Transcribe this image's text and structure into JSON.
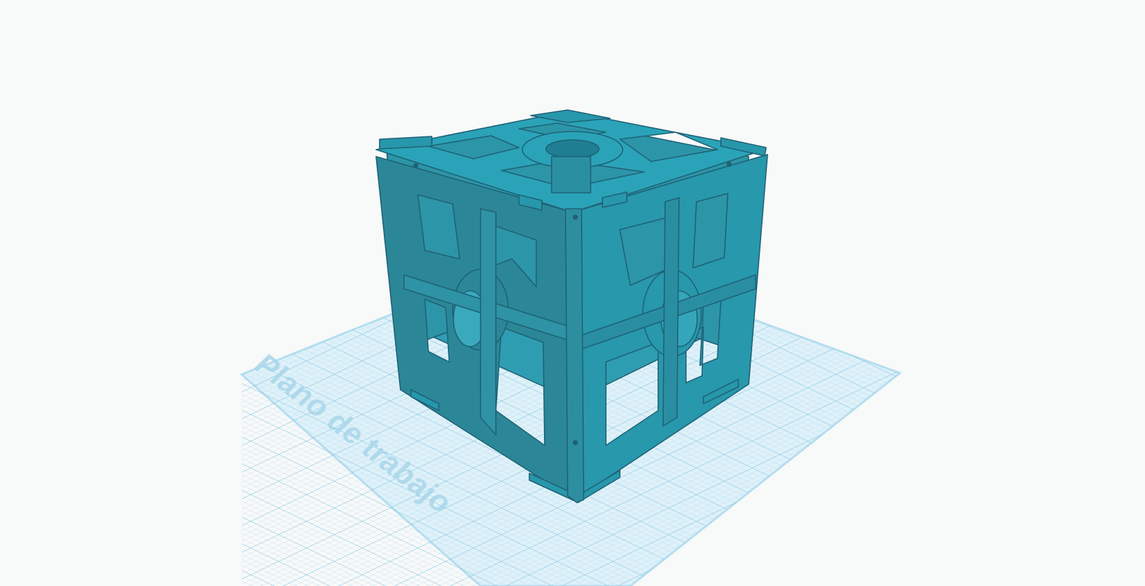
{
  "viewport": {
    "workplane_label": "Plano de trabajo"
  },
  "colors": {
    "background": "#f8f9f9",
    "workplane_fill": "#d6eef8",
    "workplane_grid": "#9fd3ea",
    "workplane_text": "#9ccfe6",
    "model_top": "#2aa3b8",
    "model_side_left": "#2b8a9a",
    "model_side_right": "#2797ab",
    "model_edge": "#1e5f72"
  },
  "scene": {
    "object": "laser-cut cube frame",
    "object_icon": "cube-icon"
  }
}
